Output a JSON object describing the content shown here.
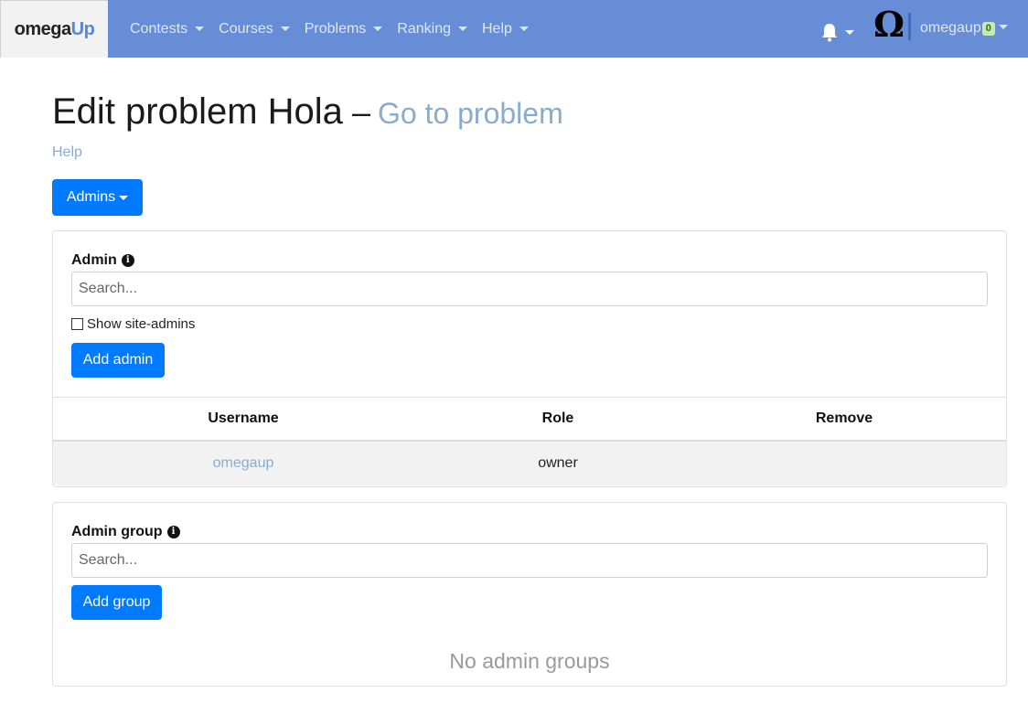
{
  "navbar": {
    "brand_omega": "omega",
    "brand_up": "Up",
    "items": [
      {
        "label": "Contests"
      },
      {
        "label": "Courses"
      },
      {
        "label": "Problems"
      },
      {
        "label": "Ranking"
      },
      {
        "label": "Help"
      }
    ],
    "avatar_glyph": "Ω",
    "username": "omegaup",
    "notification_count": "0",
    "colors": {
      "bar": "#678dd7",
      "brand_bg": "#f2f2f2",
      "accent": "#5588dd"
    }
  },
  "header": {
    "title": "Edit problem Hola",
    "separator": "–",
    "goto_link": "Go to problem",
    "help_link": "Help"
  },
  "admins_dropdown": {
    "label": "Admins"
  },
  "admin_card": {
    "label": "Admin",
    "search_placeholder": "Search...",
    "show_site_admins": "Show site-admins",
    "add_button": "Add admin",
    "table": {
      "headers": [
        "Username",
        "Role",
        "Remove"
      ],
      "rows": [
        {
          "username": "omegaup",
          "role": "owner",
          "remove": ""
        }
      ]
    }
  },
  "group_card": {
    "label": "Admin group",
    "search_placeholder": "Search...",
    "add_button": "Add group",
    "empty_text": "No admin groups"
  },
  "colors": {
    "primary": "#007bff",
    "link": "#8aaccc"
  }
}
